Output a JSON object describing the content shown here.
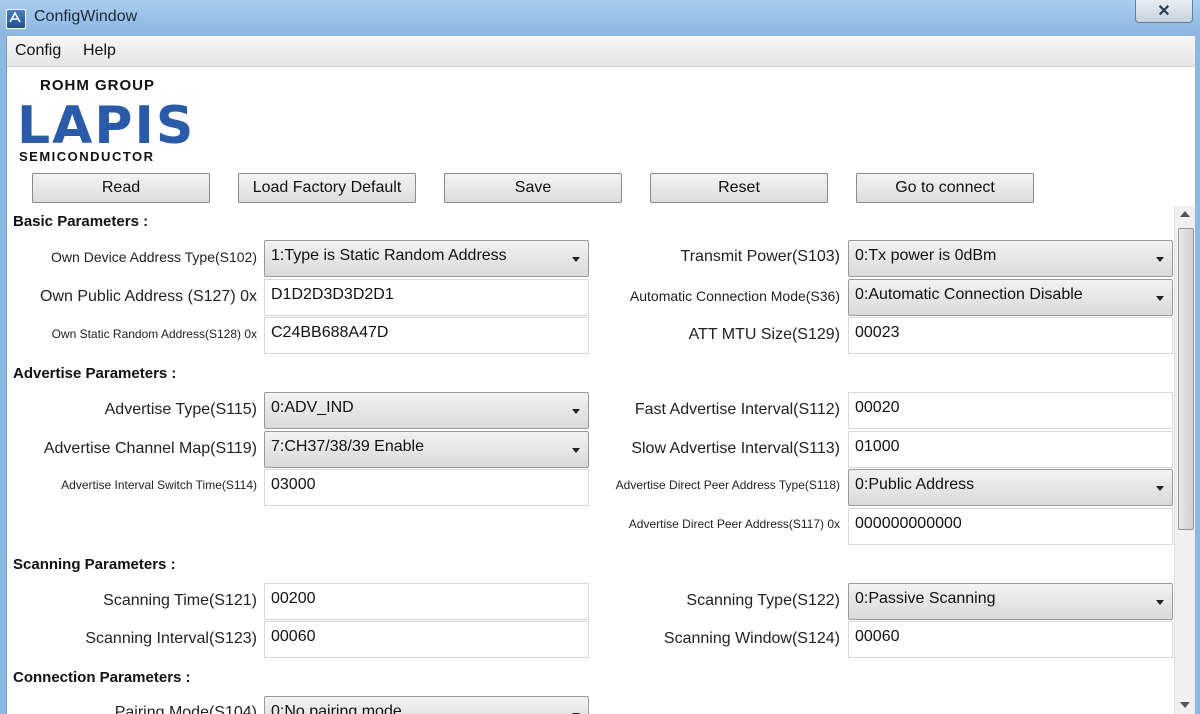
{
  "window": {
    "title": "ConfigWindow",
    "close_glyph": "✕"
  },
  "menu": {
    "config": "Config",
    "help": "Help"
  },
  "logo": {
    "group": "ROHM GROUP",
    "brand": "LAPIS",
    "sub": "SEMICONDUCTOR"
  },
  "toolbar": {
    "read": "Read",
    "factory": "Load Factory Default",
    "save": "Save",
    "reset": "Reset",
    "connect": "Go to connect"
  },
  "basic": {
    "title": "Basic Parameters :",
    "addr_type_label": "Own Device Address Type(S102)",
    "addr_type_value": "1:Type is Static Random Address",
    "public_label": "Own Public Address (S127) 0x",
    "public_value": "D1D2D3D3D2D1",
    "static_label": "Own Static Random Address(S128) 0x",
    "static_value": "C24BB688A47D",
    "tx_label": "Transmit Power(S103)",
    "tx_value": "0:Tx power is 0dBm",
    "autoconn_label": "Automatic Connection Mode(S36)",
    "autoconn_value": "0:Automatic Connection Disable",
    "mtu_label": "ATT MTU Size(S129)",
    "mtu_value": "00023"
  },
  "advertise": {
    "title": "Advertise Parameters :",
    "type_label": "Advertise Type(S115)",
    "type_value": "0:ADV_IND",
    "chmap_label": "Advertise Channel Map(S119)",
    "chmap_value": "7:CH37/38/39 Enable",
    "switch_label": "Advertise Interval Switch Time(S114)",
    "switch_value": "03000",
    "fast_label": "Fast Advertise Interval(S112)",
    "fast_value": "00020",
    "slow_label": "Slow Advertise Interval(S113)",
    "slow_value": "01000",
    "peer_type_label": "Advertise Direct Peer Address Type(S118)",
    "peer_type_value": "0:Public Address",
    "peer_addr_label": "Advertise Direct Peer Address(S117) 0x",
    "peer_addr_value": "000000000000"
  },
  "scanning": {
    "title": "Scanning Parameters :",
    "time_label": "Scanning Time(S121)",
    "time_value": "00200",
    "interval_label": "Scanning Interval(S123)",
    "interval_value": "00060",
    "type_label": "Scanning Type(S122)",
    "type_value": "0:Passive Scanning",
    "window_label": "Scanning Window(S124)",
    "window_value": "00060"
  },
  "connection": {
    "title": "Connection Parameters :",
    "pairing_label": "Pairing Mode(S104)",
    "pairing_value": "0:No pairing mode"
  }
}
